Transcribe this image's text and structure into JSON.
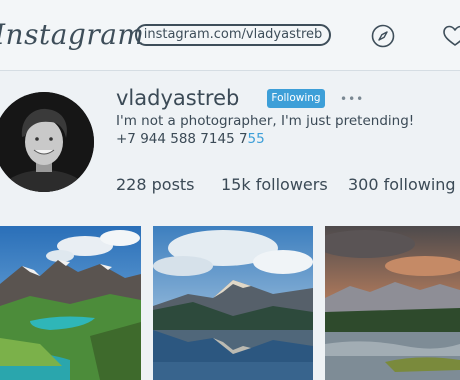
{
  "header": {
    "logo_text": "Instagram",
    "profile_url": "instagram.com/vladyastreb",
    "icons": [
      "compass-icon",
      "heart-icon"
    ]
  },
  "profile": {
    "username": "vladyastreb",
    "follow_status": "Following",
    "more": "•••",
    "bio": "I'm not a photographer, I'm just pretending!",
    "phone_main": "+7 944 588 7145 7",
    "phone_highlight": "55"
  },
  "stats": {
    "posts": "228 posts",
    "followers": "15k followers",
    "following": "300 following"
  },
  "colors": {
    "accent": "#3d9fd8",
    "text": "#3b4a56",
    "background": "#eef2f5"
  },
  "photos": [
    {
      "subject": "alpine lake with green meadows"
    },
    {
      "subject": "mountain reflected in lake"
    },
    {
      "subject": "mountains and lake at sunset"
    }
  ]
}
